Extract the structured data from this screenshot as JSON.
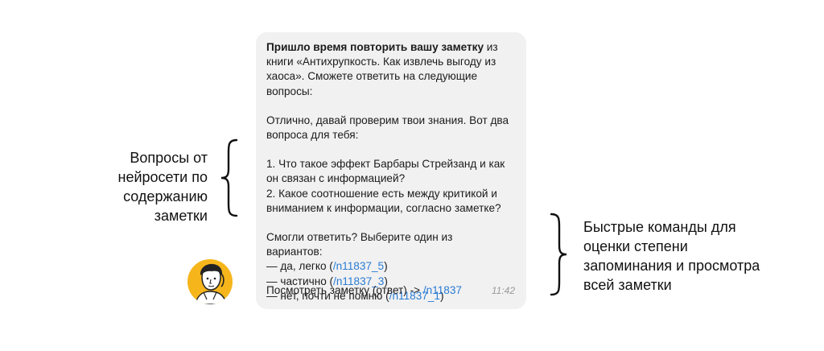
{
  "message": {
    "intro_bold": "Пришло время повторить вашу заметку",
    "intro_rest": " из книги «Антихрупкость. Как извлечь выгоду из хаоса». Сможете ответить на следующие вопросы:",
    "ai_intro": "Отлично, давай проверим твои знания. Вот два вопроса для тебя:",
    "question_1": "1. Что такое эффект Барбары Стрейзанд и как он связан с информацией?",
    "question_2": "2. Какое соотношение есть между критикой и вниманием к информации, согласно заметке?",
    "prompt_line_1": "Смогли ответить? Выберите один из",
    "prompt_line_2": "вариантов:",
    "options": [
      {
        "prefix": "— да, легко (",
        "command": "/n11837_5",
        "suffix": ")"
      },
      {
        "prefix": "— частично (",
        "command": "/n11837_3",
        "suffix": ")"
      },
      {
        "prefix": "— нет, почти не помню (",
        "command": "/n11837_1",
        "suffix": ")"
      }
    ],
    "view_prefix": "Посмотреть заметку (ответ) -> ",
    "view_command": "/n11837",
    "time": "11:42"
  },
  "annotations": {
    "left_lines": [
      "Вопросы от",
      "нейросети по",
      "содержанию заметки"
    ],
    "right_lines": [
      "Быстрые команды для",
      "оценки степени",
      "запоминания и просмотра",
      "всей заметки"
    ]
  },
  "colors": {
    "bubble": "#f1f1f2",
    "link": "#2a7cd3",
    "avatar_bg": "#f5b51b"
  },
  "icons": {
    "avatar": "illustrated-person-avatar"
  }
}
